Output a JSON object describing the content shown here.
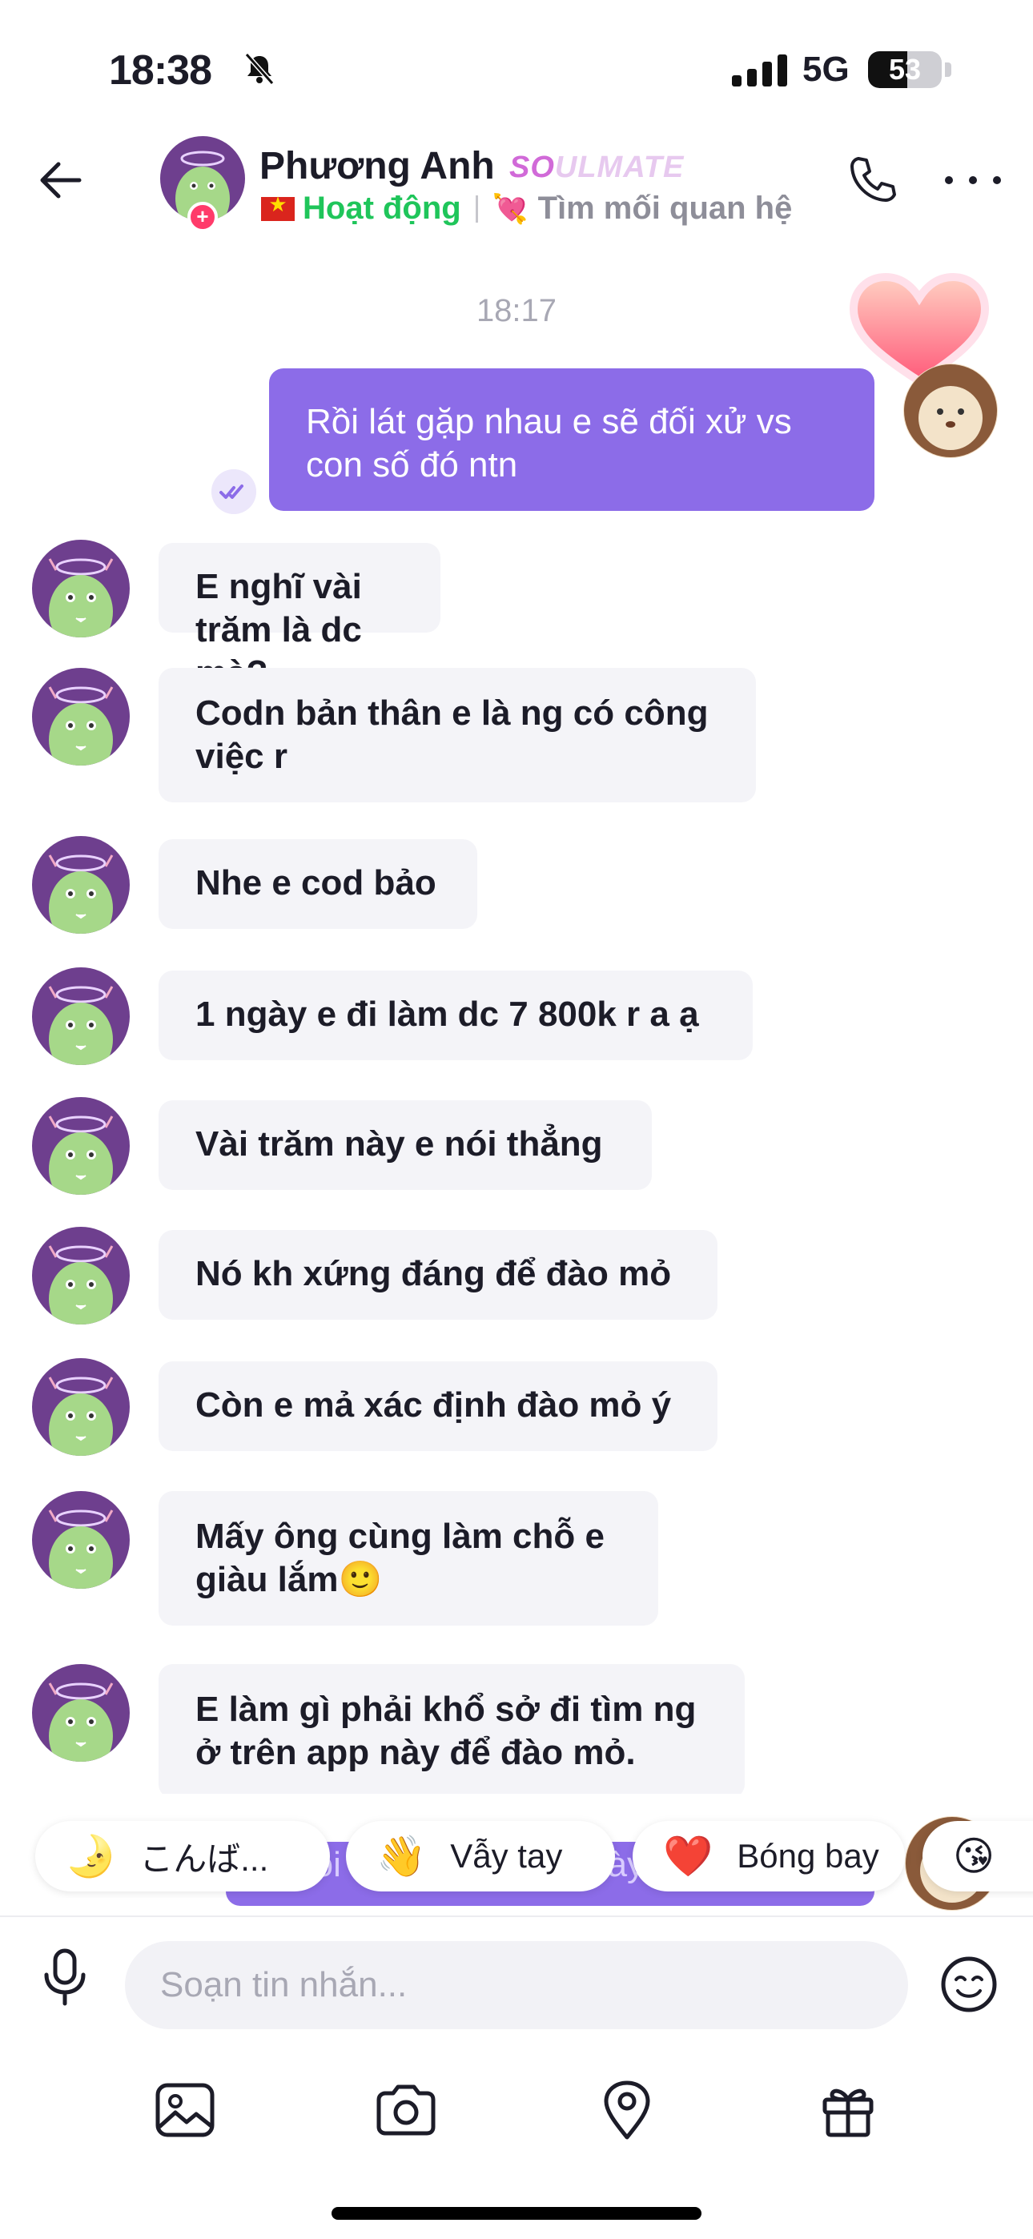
{
  "status_bar": {
    "time": "18:38",
    "network": "5G",
    "battery": "53",
    "battery_level": 0.53
  },
  "header": {
    "name": "Phương Anh",
    "badge_highlight": "SO",
    "badge_rest": "ULMATE",
    "status": "Hoạt động",
    "relationship": "Tìm mối quan hệ"
  },
  "chat": {
    "timestamp": "18:17",
    "my_message_line1": "Rồi lát gặp nhau e sẽ đối xử vs",
    "my_message_line2": "con số đó ntn",
    "their_messages": [
      {
        "line1": "E nghĩ vài trăm là dc mà?",
        "line2": ""
      },
      {
        "line1": "Codn bản thân e là ng có công",
        "line2": "việc r"
      },
      {
        "line1": "Nhe e cod bảo",
        "line2": ""
      },
      {
        "line1": "1 ngày e đi làm dc 7 800k r a ạ",
        "line2": ""
      },
      {
        "line1": "Vài trăm này e nói thẳng",
        "line2": ""
      },
      {
        "line1": "Nó kh xứng đáng để đào mỏ",
        "line2": ""
      },
      {
        "line1": "Còn e mả xác định đào mỏ ý",
        "line2": ""
      },
      {
        "line1": "Mấy ông cùng làm chỗ e",
        "line2": "giàu lắm🙂"
      },
      {
        "line1": "E làm gì phải khổ sở đi tìm ng",
        "line2": "ở trên app này để đào mỏ."
      }
    ],
    "peek_message": "A nói e nghe nè.trên này ko ai"
  },
  "quick_replies": [
    {
      "emoji": "🌛",
      "label": "こんば..."
    },
    {
      "emoji": "👋",
      "label": "Vẫy tay"
    },
    {
      "emoji": "❤️",
      "label": "Bóng bay"
    },
    {
      "emoji": "😘",
      "label": ""
    }
  ],
  "composer": {
    "placeholder": "Soạn tin nhắn..."
  },
  "colors": {
    "accent": "#8c6ce8",
    "online": "#1fc55a",
    "soulmate": "#d16ad8"
  }
}
